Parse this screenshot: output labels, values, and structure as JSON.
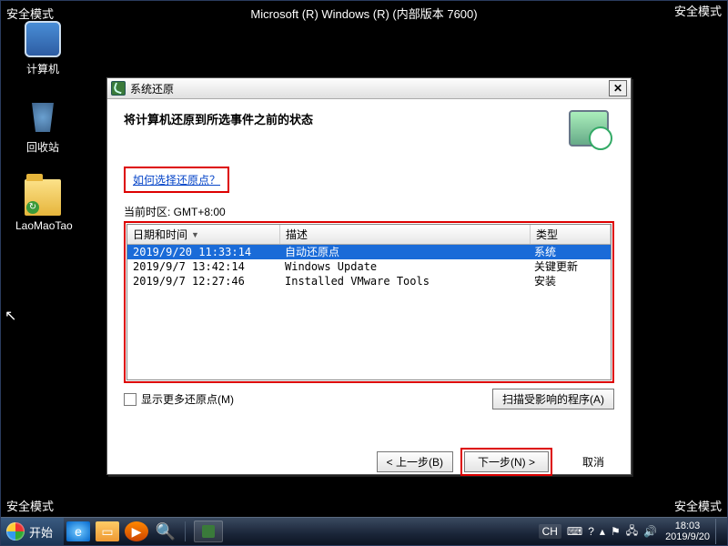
{
  "safe_mode_label": "安全模式",
  "os_title": "Microsoft (R) Windows (R) (内部版本 7600)",
  "desktop_icons": {
    "computer": "计算机",
    "recycle": "回收站",
    "folder": "LaoMaoTao"
  },
  "window": {
    "title": "系统还原",
    "heading": "将计算机还原到所选事件之前的状态",
    "help_link": "如何选择还原点？",
    "timezone_label": "当前时区: GMT+8:00",
    "columns": {
      "c0": "日期和时间",
      "c1": "描述",
      "c2": "类型"
    },
    "rows": [
      {
        "date": "2019/9/20 11:33:14",
        "desc": "自动还原点",
        "type": "系统",
        "selected": true
      },
      {
        "date": "2019/9/7 13:42:14",
        "desc": "Windows Update",
        "type": "关键更新",
        "selected": false
      },
      {
        "date": "2019/9/7 12:27:46",
        "desc": "Installed VMware Tools",
        "type": "安装",
        "selected": false
      }
    ],
    "show_more": "显示更多还原点(M)",
    "scan_btn": "扫描受影响的程序(A)",
    "back_btn": "< 上一步(B)",
    "next_btn": "下一步(N) >",
    "cancel_btn": "取消"
  },
  "taskbar": {
    "start": "开始",
    "lang": "CH",
    "time": "18:03",
    "date": "2019/9/20"
  }
}
